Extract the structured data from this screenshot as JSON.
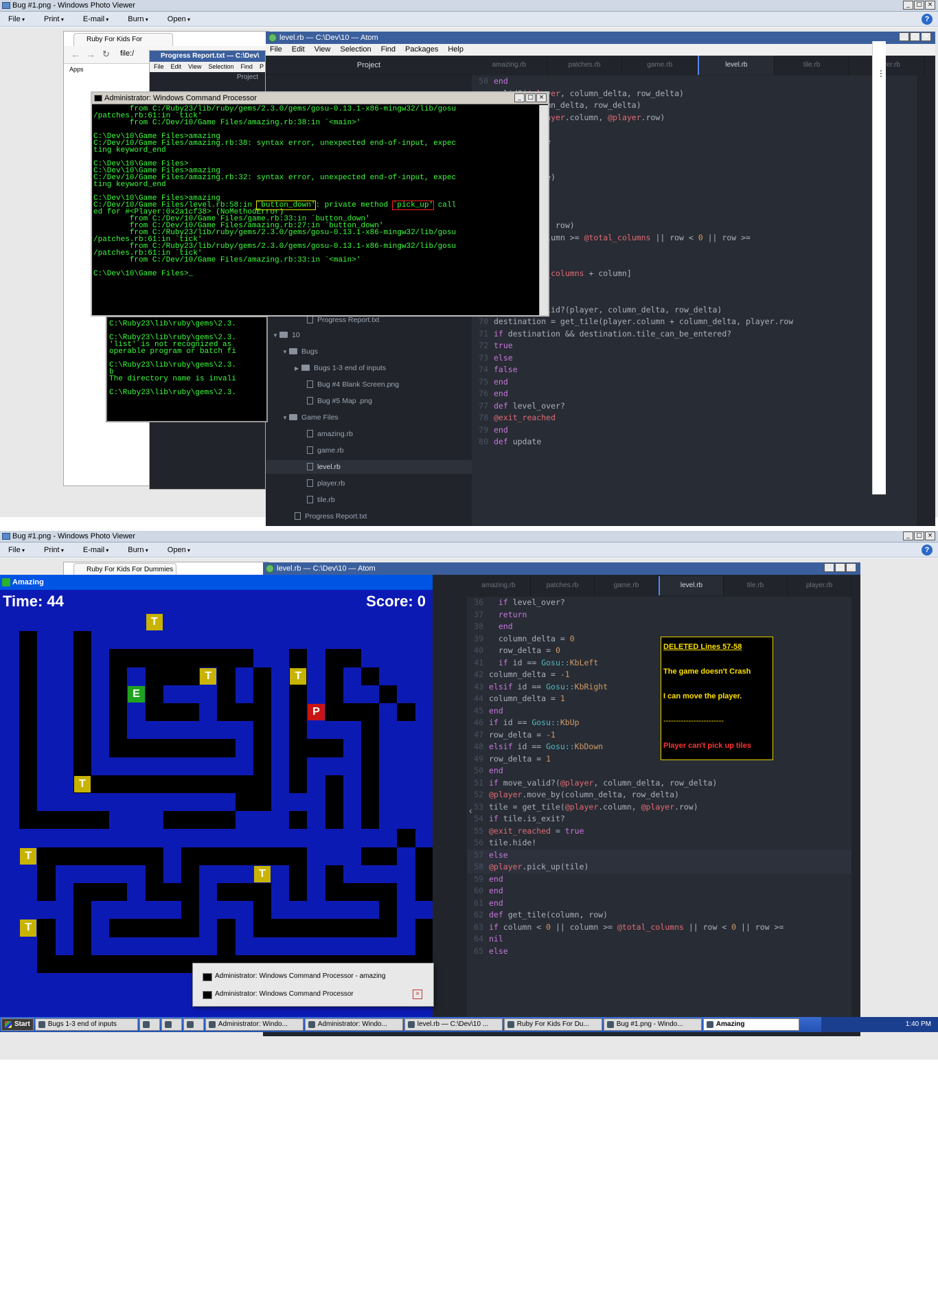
{
  "photo_viewer": {
    "title": "Bug #1.png - Windows Photo Viewer",
    "menu": [
      "File",
      "Print",
      "E-mail",
      "Burn",
      "Open"
    ],
    "help": "?"
  },
  "browser": {
    "tab": "Ruby For Kids For Dummies",
    "address": "file:/",
    "bookmarks": [
      "Apps"
    ]
  },
  "atom1": {
    "title": "level.rb — C:\\Dev\\10 — Atom",
    "menu": [
      "File",
      "Edit",
      "View",
      "Selection",
      "Find",
      "Packages",
      "Help"
    ],
    "project_label": "Project",
    "tabs": [
      "amazing.rb",
      "patches.rb",
      "game.rb",
      "level.rb",
      "tile.rb",
      "player.rb"
    ],
    "tree": [
      "Progress Report.txt",
      "10",
      "Bugs",
      "Bugs 1-3 end of inputs",
      "Bug #4 Blank Screen.png",
      "Bug #5 Map .png",
      "Game Files",
      "amazing.rb",
      "game.rb",
      "level.rb",
      "player.rb",
      "tile.rb",
      "Progress Report.txt"
    ]
  },
  "progress_report": {
    "title": "Progress Report.txt — C:\\Dev\\",
    "menu": [
      "File",
      "Edit",
      "View",
      "Selection",
      "Find",
      "P"
    ],
    "project_label": "Project"
  },
  "cmd1": {
    "title": "Administrator: Windows Command Processor",
    "lines": [
      "        from C:/Ruby23/lib/ruby/gems/2.3.0/gems/gosu-0.13.1-x86-mingw32/lib/gosu",
      "/patches.rb:61:in `tick'",
      "        from C:/Dev/10/Game Files/amazing.rb:38:in `<main>'",
      "",
      "C:\\Dev\\10\\Game Files>amazing",
      "C:/Dev/10/Game Files/amazing.rb:38: syntax error, unexpected end-of-input, expec",
      "ting keyword_end",
      "",
      "C:\\Dev\\10\\Game Files>",
      "C:\\Dev\\10\\Game Files>amazing",
      "C:/Dev/10/Game Files/amazing.rb:32: syntax error, unexpected end-of-input, expec",
      "ting keyword_end",
      "",
      "C:\\Dev\\10\\Game Files>amazing",
      "C:/Dev/10/Game Files/level.rb:58:in `button_down': private method `pick_up' call",
      "ed for #<Player:0x2a1cf38> (NoMethodError)",
      "        from C:/Dev/10/Game Files/game.rb:33:in `button_down'",
      "        from C:/Dev/10/Game Files/amazing.rb:27:in `button_down'",
      "        from C:/Ruby23/lib/ruby/gems/2.3.0/gems/gosu-0.13.1-x86-mingw32/lib/gosu",
      "/patches.rb:61:in `tick'",
      "        from C:/Ruby23/lib/ruby/gems/2.3.0/gems/gosu-0.13.1-x86-mingw32/lib/gosu",
      "/patches.rb:61:in `tick'",
      "        from C:/Dev/10/Game Files/amazing.rb:33:in `<main>'",
      "",
      "C:\\Dev\\10\\Game Files>_"
    ]
  },
  "cmd2": {
    "lines": [
      "C:\\Ruby23\\lib\\ruby\\gems\\2.3.",
      "",
      "C:\\Ruby23\\lib\\ruby\\gems\\2.3.",
      "'list' is not recognized as",
      "operable program or batch fi",
      "",
      "C:\\Ruby23\\lib\\ruby\\gems\\2.3.",
      "b",
      "The directory name is invali",
      "",
      "C:\\Ruby23\\lib\\ruby\\gems\\2.3."
    ]
  },
  "code1": [
    {
      "n": "50",
      "t": "end"
    },
    {
      "n": "",
      "t": "valid?(@player, column_delta, row_delta)"
    },
    {
      "n": "",
      "t": "ove_by(column_delta, row_delta)"
    },
    {
      "n": "",
      "t": "et_tile(@player.column, @player.row)"
    },
    {
      "n": "",
      "t": "s_exit?"
    },
    {
      "n": "",
      "t": "ached = true"
    },
    {
      "n": "",
      "t": "e!"
    },
    {
      "n": "",
      "t": ""
    },
    {
      "n": "",
      "t": "pick_up(tile)"
    },
    {
      "n": "",
      "t": ""
    },
    {
      "n": "",
      "t": ""
    },
    {
      "n": "",
      "t": ""
    },
    {
      "n": "",
      "t": "tile(column, row)"
    },
    {
      "n": "",
      "t": "n < 0 || column >= @total_columns || row < 0 || row >="
    },
    {
      "n": "",
      "t": ""
    },
    {
      "n": "",
      "t": ""
    },
    {
      "n": "",
      "t": "ow * @total_columns + column]"
    },
    {
      "n": "67",
      "t": "end"
    },
    {
      "n": "68",
      "t": "end"
    },
    {
      "n": "69",
      "t": "def move_valid?(player, column_delta, row_delta)"
    },
    {
      "n": "70",
      "t": "destination = get_tile(player.column + column_delta, player.row"
    },
    {
      "n": "71",
      "t": "if destination && destination.tile_can_be_entered?"
    },
    {
      "n": "72",
      "t": "true"
    },
    {
      "n": "73",
      "t": "else"
    },
    {
      "n": "74",
      "t": "false"
    },
    {
      "n": "75",
      "t": "end"
    },
    {
      "n": "76",
      "t": "end"
    },
    {
      "n": "77",
      "t": "def level_over?"
    },
    {
      "n": "78",
      "t": "@exit_reached"
    },
    {
      "n": "79",
      "t": "end"
    },
    {
      "n": "80",
      "t": "def update"
    }
  ],
  "code2": [
    {
      "n": "36",
      "t": "  if level_over?"
    },
    {
      "n": "37",
      "t": "  return"
    },
    {
      "n": "38",
      "t": "  end"
    },
    {
      "n": "39",
      "t": "  column_delta = 0"
    },
    {
      "n": "40",
      "t": "  row_delta = 0"
    },
    {
      "n": "41",
      "t": "  if id == Gosu::KbLeft"
    },
    {
      "n": "42",
      "t": "column_delta = -1"
    },
    {
      "n": "43",
      "t": "elsif id == Gosu::KbRight"
    },
    {
      "n": "44",
      "t": "column_delta = 1"
    },
    {
      "n": "45",
      "t": "end"
    },
    {
      "n": "46",
      "t": "if id == Gosu::KbUp"
    },
    {
      "n": "47",
      "t": "row_delta = -1"
    },
    {
      "n": "48",
      "t": "elsif id == Gosu::KbDown"
    },
    {
      "n": "49",
      "t": "row_delta = 1"
    },
    {
      "n": "50",
      "t": "end"
    },
    {
      "n": "51",
      "t": "if move_valid?(@player, column_delta, row_delta)"
    },
    {
      "n": "52",
      "t": "@player.move_by(column_delta, row_delta)"
    },
    {
      "n": "53",
      "t": "tile = get_tile(@player.column, @player.row)"
    },
    {
      "n": "54",
      "t": "if tile.is_exit?"
    },
    {
      "n": "55",
      "t": "@exit_reached = true"
    },
    {
      "n": "56",
      "t": "tile.hide!"
    },
    {
      "n": "57",
      "t": "else"
    },
    {
      "n": "58",
      "t": "@player.pick_up(tile)"
    },
    {
      "n": "59",
      "t": "end"
    },
    {
      "n": "60",
      "t": "end"
    },
    {
      "n": "61",
      "t": "end"
    },
    {
      "n": "62",
      "t": "def get_tile(column, row)"
    },
    {
      "n": "63",
      "t": "if column < 0 || column >= @total_columns || row < 0 || row >="
    },
    {
      "n": "64",
      "t": "nil"
    },
    {
      "n": "65",
      "t": "else"
    }
  ],
  "game": {
    "title": "Amazing",
    "time": "Time: 44",
    "score": "Score: 0"
  },
  "note": {
    "heading": "DELETED Lines 57-58",
    "line1": "The game doesn't Crash",
    "line2": "I can move the player.",
    "divider": "------------------------",
    "line3": "Player can't pick up tiles"
  },
  "popup": {
    "items": [
      "Administrator: Windows Command Processor - amazing",
      "Administrator: Windows Command Processor"
    ]
  },
  "taskbar": {
    "start": "Start",
    "items": [
      "Bugs 1-3 end of inputs",
      "Administrator: Windo...",
      "Administrator: Windo...",
      "level.rb — C:\\Dev\\10 ...",
      "Ruby For Kids For Du...",
      "Bug #1.png - Windo...",
      "Amazing"
    ],
    "clock": "1:40 PM"
  },
  "colors": {
    "atom_bg": "#282c34",
    "cmd_text": "#3cff3c",
    "maze_blue": "#0c1ab4",
    "note_border": "#e6d200"
  }
}
